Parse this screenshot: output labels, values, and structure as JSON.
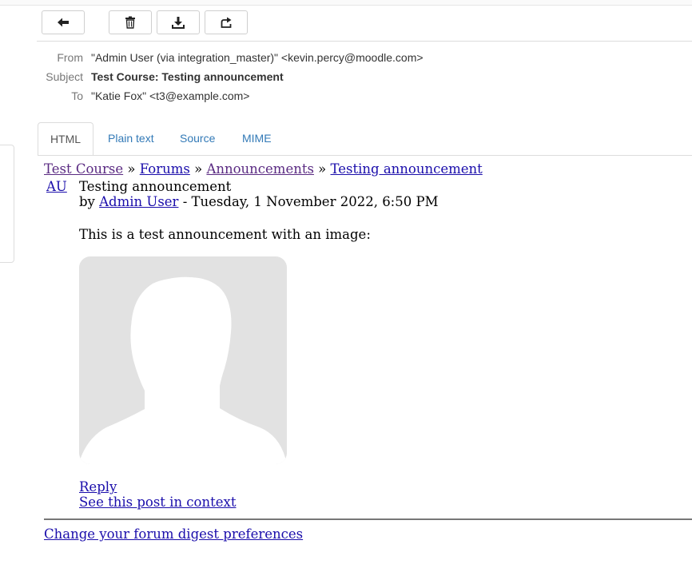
{
  "toolbar": {
    "back_icon": "arrow-left-icon",
    "delete_icon": "trash-icon",
    "download_icon": "download-icon",
    "forward_icon": "forward-icon"
  },
  "headers": {
    "from_label": "From",
    "from_value": "\"Admin User (via integration_master)\" <kevin.percy@moodle.com>",
    "subject_label": "Subject",
    "subject_value": "Test Course: Testing announcement",
    "to_label": "To",
    "to_value": "\"Katie Fox\" <t3@example.com>"
  },
  "tabs": [
    {
      "label": "HTML",
      "active": true
    },
    {
      "label": "Plain text"
    },
    {
      "label": "Source"
    },
    {
      "label": "MIME"
    }
  ],
  "message": {
    "breadcrumb": {
      "course": "Test Course",
      "sep1": " » ",
      "forums": "Forums",
      "sep2": " » ",
      "announcements": "Announcements",
      "sep3": " » ",
      "discussion": "Testing announcement"
    },
    "avatar_initials": "AU",
    "post_title": "Testing announcement",
    "by_prefix": "by ",
    "author": "Admin User",
    "date": " - Tuesday, 1 November 2022, 6:50 PM",
    "body": "This is a test announcement with an image:",
    "image_icon": "person-silhouette-icon",
    "reply_link": "Reply",
    "context_link": "See this post in context",
    "digest_link": "Change your forum digest preferences"
  },
  "colors": {
    "link": "#1a0dab",
    "visited_link": "#5a2a82",
    "tab_link": "#337ab7",
    "image_bg": "#e2e2e2"
  }
}
